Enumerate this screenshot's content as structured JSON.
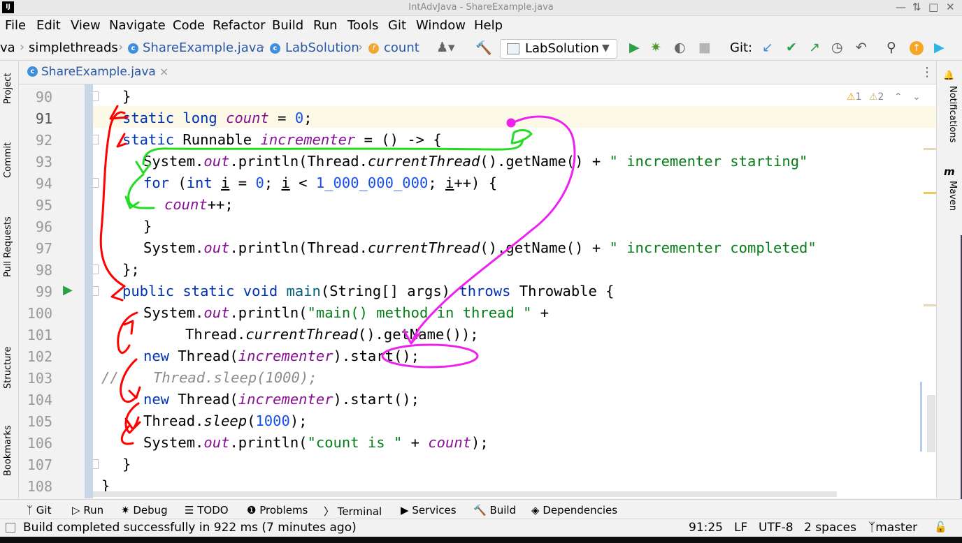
{
  "window": {
    "title": "IntAdvJava - ShareExample.java",
    "logo": "IJ"
  },
  "menu": [
    "File",
    "Edit",
    "View",
    "Navigate",
    "Code",
    "Refactor",
    "Build",
    "Run",
    "Tools",
    "Git",
    "Window",
    "Help"
  ],
  "breadcrumbs": {
    "project": "va",
    "package": "simplethreads",
    "file": "ShareExample.java",
    "class": "LabSolution",
    "field": "count"
  },
  "toolbar": {
    "run_config": "LabSolution",
    "git_label": "Git:"
  },
  "left_tools": [
    "Project",
    "Commit",
    "Pull Requests",
    "Structure",
    "Bookmarks"
  ],
  "right_tools": [
    "Notifications",
    "Maven"
  ],
  "editor_tab": {
    "name": "ShareExample.java",
    "close": "×"
  },
  "inspections": {
    "warnings": "1",
    "weak_warnings": "2"
  },
  "line_numbers": [
    "90",
    "91",
    "92",
    "93",
    "94",
    "95",
    "96",
    "97",
    "98",
    "99",
    "100",
    "101",
    "102",
    "103",
    "104",
    "105",
    "106",
    "107",
    "108"
  ],
  "code": {
    "l90": "}",
    "l91a": "static long ",
    "l91b": "count",
    "l91c": " = ",
    "l91d": "0",
    "l91e": ";",
    "l92a": "static ",
    "l92b": "Runnable ",
    "l92c": "incrementer",
    "l92d": " = () -> {",
    "l93a": "System.",
    "l93b": "out",
    "l93c": ".println(Thread.",
    "l93d": "currentThread",
    "l93e": "().getName() + ",
    "l93f": "\" incrementer starting\"",
    "l94a": "for ",
    "l94b": "(",
    "l94c": "int ",
    "l94d": "i",
    "l94e": " = ",
    "l94f": "0",
    "l94g": "; ",
    "l94h": "i",
    "l94i": " < ",
    "l94j": "1_000_000_000",
    "l94k": "; ",
    "l94l": "i",
    "l94m": "++) {",
    "l95a": "count",
    "l95b": "++;",
    "l96": "}",
    "l97a": "System.",
    "l97b": "out",
    "l97c": ".println(Thread.",
    "l97d": "currentThread",
    "l97e": "().getName() + ",
    "l97f": "\" incrementer completed\"",
    "l98": "};",
    "l99a": "public static void ",
    "l99b": "main",
    "l99c": "(String[] args) ",
    "l99d": "throws ",
    "l99e": "Throwable {",
    "l100a": "System.",
    "l100b": "out",
    "l100c": ".println(",
    "l100d": "\"main() method in thread \"",
    "l100e": " +",
    "l101a": "Thread.",
    "l101b": "currentThread",
    "l101c": "().getName());",
    "l102a": "new ",
    "l102b": "Thread(",
    "l102c": "incrementer",
    "l102d": ").start();",
    "l103a": "//",
    "l103b": "    Thread.sleep(1000);",
    "l104a": "new ",
    "l104b": "Thread(",
    "l104c": "incrementer",
    "l104d": ").start();",
    "l105a": "Thread.",
    "l105b": "sleep",
    "l105c": "(",
    "l105d": "1000",
    "l105e": ");",
    "l106a": "System.",
    "l106b": "out",
    "l106c": ".println(",
    "l106d": "\"count is \"",
    "l106e": " + ",
    "l106f": "count",
    "l106g": ");",
    "l107": "}",
    "l108": "}"
  },
  "tool_windows": [
    "Git",
    "Run",
    "Debug",
    "TODO",
    "Problems",
    "Terminal",
    "Services",
    "Build",
    "Dependencies"
  ],
  "status": {
    "message": "Build completed successfully in 922 ms (7 minutes ago)",
    "position": "91:25",
    "line_ending": "LF",
    "encoding": "UTF-8",
    "indent": "2 spaces",
    "branch": "master"
  },
  "colors": {
    "keyword": "#0033b3",
    "field": "#871094",
    "string": "#067d17",
    "number": "#1750eb",
    "annotation_red": "#ff0000",
    "annotation_green": "#22dd22",
    "annotation_magenta": "#ee22ee"
  }
}
